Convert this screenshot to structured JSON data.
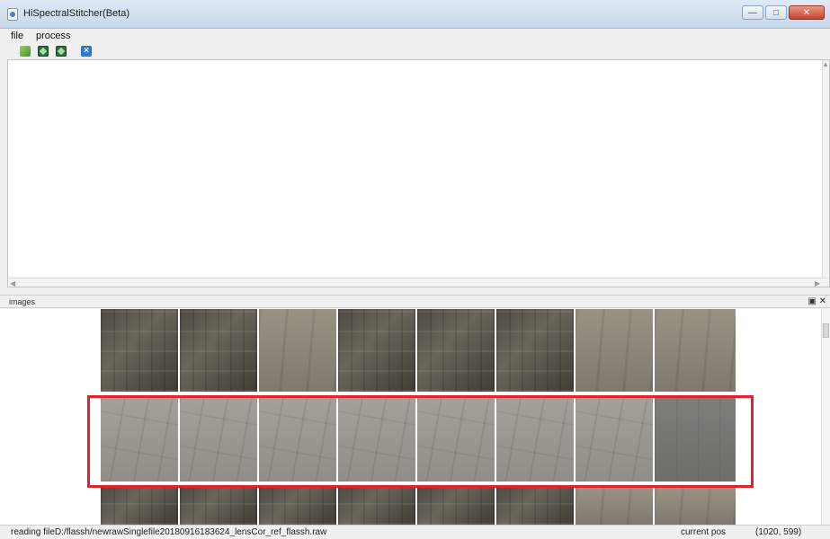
{
  "window": {
    "title": "HiSpectralStitcher(Beta)",
    "controls": [
      "minimize",
      "maximize",
      "close"
    ]
  },
  "menu": {
    "items": [
      "file",
      "process"
    ]
  },
  "toolbar": {
    "icons": [
      "folder-open-icon",
      "map-icon",
      "map-alt-icon",
      "close-x-icon"
    ]
  },
  "panels": {
    "images_title": "images"
  },
  "status": {
    "text": "reading fileD:/flassh/newrawSinglefile20180916183624_lensCor_ref_flassh.raw",
    "pos_label": "current pos",
    "pos_value": "(1020, 599)"
  },
  "colors": {
    "selection_border": "#e0242a",
    "title_bar": "#c7d8ec"
  }
}
